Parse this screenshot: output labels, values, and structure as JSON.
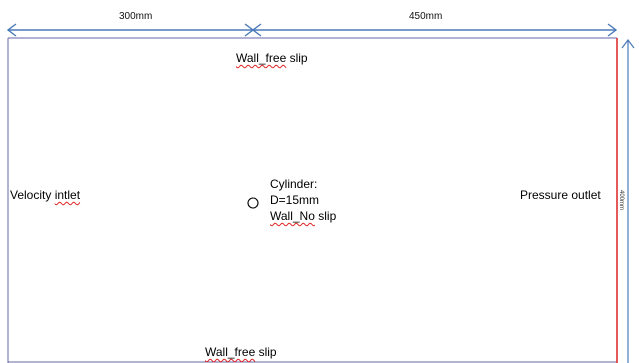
{
  "dimensions": {
    "left_length": "300mm",
    "right_length": "450mm",
    "height": "400mm"
  },
  "boundaries": {
    "top": {
      "name_underlined": "Wall_free",
      "rest": "slip"
    },
    "bottom": {
      "name_underlined": "Wall_free",
      "rest": "slip"
    },
    "inlet": {
      "prefix": "Velocity ",
      "underlined": "intlet"
    },
    "outlet": "Pressure outlet"
  },
  "cylinder": {
    "title": "Cylinder:",
    "diameter": "D=15mm",
    "wall_underlined": "Wall_No",
    "wall_rest": "slip"
  },
  "colors": {
    "domain_border": "#6666aa",
    "dimension_arrow": "#4a7ab8",
    "outlet_line": "#e03030",
    "squiggle": "#e02020"
  }
}
